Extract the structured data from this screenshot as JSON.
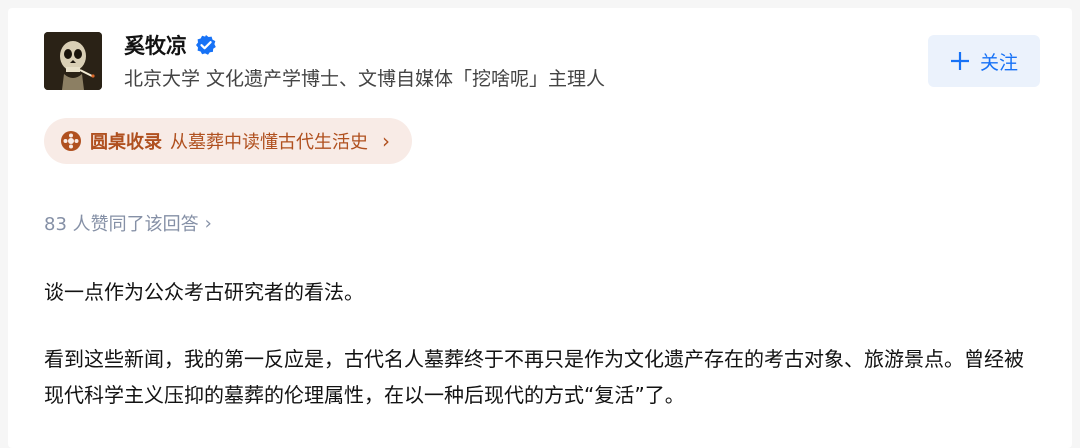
{
  "author": {
    "name": "奚牧凉",
    "bio": "北京大学 文化遗产学博士、文博自媒体「挖啥呢」主理人",
    "verified_icon": "verified-check-icon"
  },
  "follow_button": {
    "label": "关注",
    "icon": "plus-icon"
  },
  "collection": {
    "label": "圆桌收录",
    "title": "从墓葬中读懂古代生活史",
    "chevron": "›"
  },
  "votes": {
    "text": "83 人赞同了该回答",
    "chevron": "›"
  },
  "content": {
    "paragraph_1": "谈一点作为公众考古研究者的看法。",
    "paragraph_2": "看到这些新闻，我的第一反应是，古代名人墓葬终于不再只是作为文化遗产存在的考古对象、旅游景点。曾经被现代科学主义压抑的墓葬的伦理属性，在以一种后现代的方式“复活”了。"
  },
  "colors": {
    "accent_blue": "#1772f6",
    "follow_bg": "#ebf2fc",
    "collection_text": "#b0501f",
    "collection_bg": "#f8ebe6",
    "muted_text": "#8590a6"
  }
}
